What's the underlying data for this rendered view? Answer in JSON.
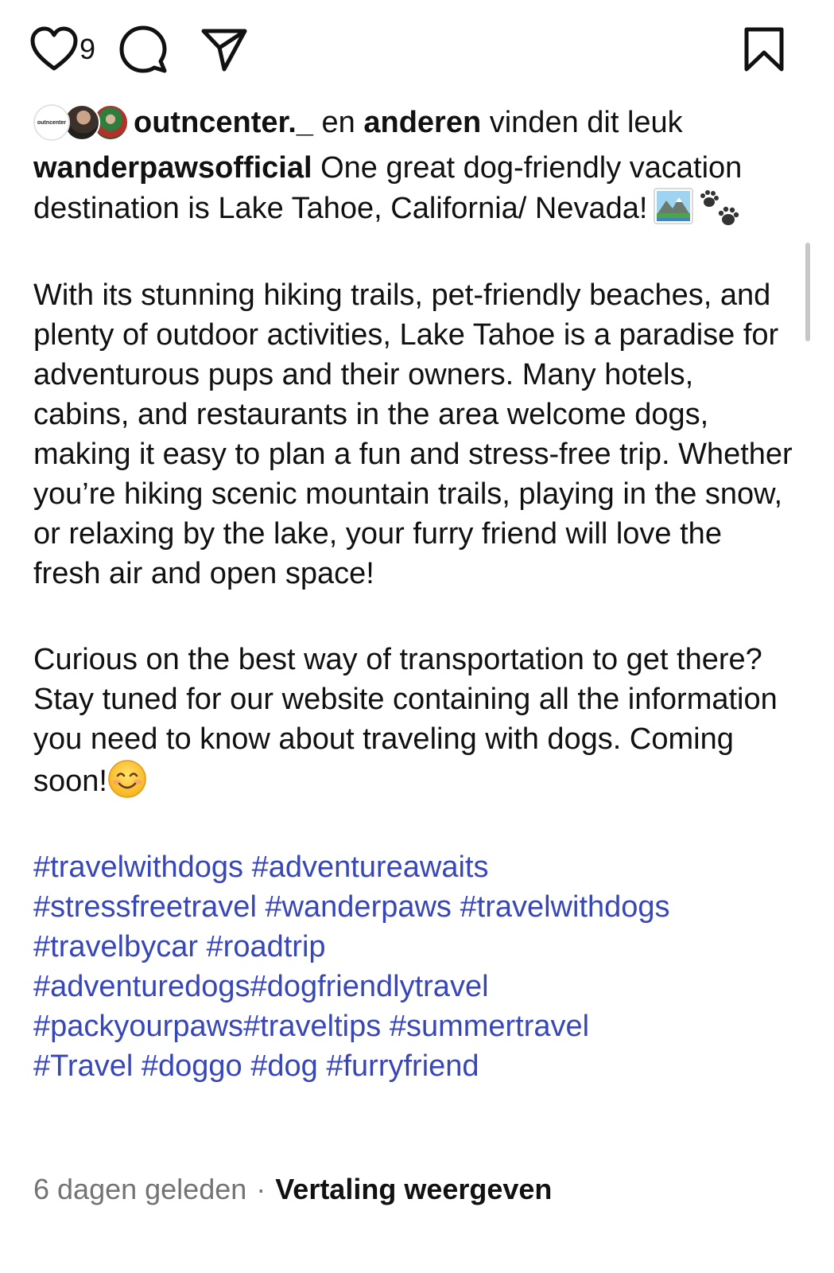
{
  "actions": {
    "like_count": "9",
    "icons": [
      "heart-icon",
      "comment-icon",
      "share-icon",
      "bookmark-icon"
    ]
  },
  "likes": {
    "first_user": "outncenter._",
    "connector": " en ",
    "others": "anderen",
    "suffix": " vinden dit leuk",
    "avatar1_text": "outncenter"
  },
  "caption": {
    "username": "wanderpawsofficial",
    "intro": " One great dog-friendly vacation destination is Lake Tahoe, California/ Nevada!",
    "paragraph1": "With its stunning hiking trails, pet-friendly beaches, and plenty of outdoor activities, Lake Tahoe is a paradise for adventurous pups and their owners. Many hotels, cabins, and restaurants in the area welcome dogs, making it easy to plan a fun and stress-free trip. Whether you’re hiking scenic mountain trails, playing in the snow, or relaxing by the lake, your furry friend will love the fresh air and open space!",
    "paragraph2": "Curious on the best way of transportation to get there? Stay tuned for our website containing all the information you need to know about traveling with dogs. Coming soon!",
    "emojis": [
      "mountain-emoji",
      "paw-prints-emoji",
      "smiling-face-emoji"
    ]
  },
  "hashtags": {
    "line1": [
      "#travelwithdogs",
      "#adventureawaits"
    ],
    "line2": [
      "#stressfreetravel",
      "#wanderpaws",
      "#travelwithdogs"
    ],
    "line3": [
      "#travelbycar",
      "#roadtrip"
    ],
    "line4": [
      "#adventuredogs",
      "#dogfriendlytravel"
    ],
    "line5": [
      "#packyourpaws",
      "#traveltips",
      "#summertravel"
    ],
    "line6": [
      "#Travel",
      "#doggo",
      "#dog",
      "#furryfriend"
    ]
  },
  "footer": {
    "time": "6 dagen geleden",
    "separator": "·",
    "translate": "Vertaling weergeven"
  },
  "colors": {
    "hashtag": "#3847b8",
    "muted": "#737373",
    "text": "#111111"
  }
}
